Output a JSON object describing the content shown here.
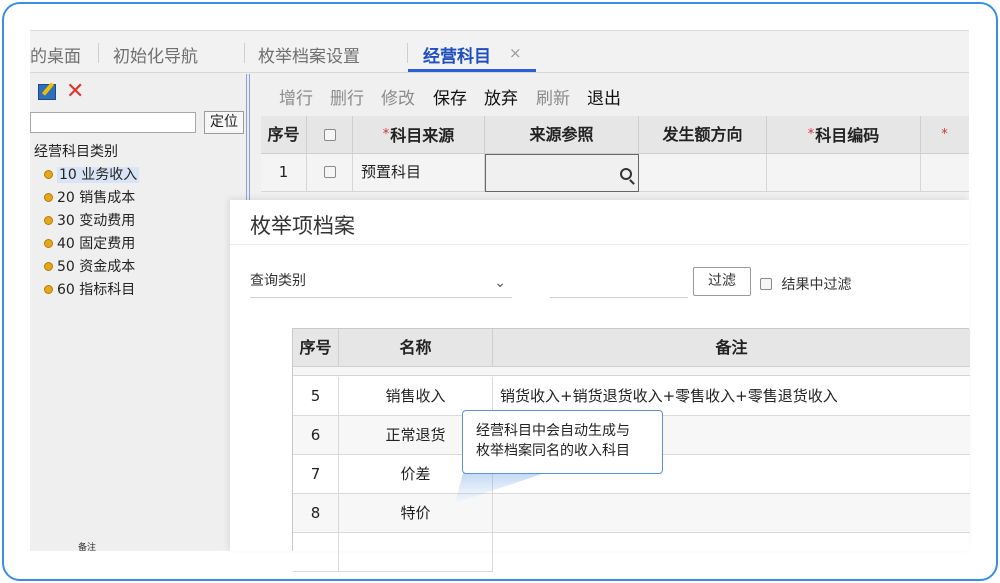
{
  "tabs": [
    {
      "label": "的桌面",
      "active": false
    },
    {
      "label": "初始化导航",
      "active": false
    },
    {
      "label": "枚举档案设置",
      "active": false
    },
    {
      "label": "经营科目",
      "active": true
    }
  ],
  "tab_close_glyph": "×",
  "left_panel": {
    "delete_glyph": "✕",
    "search_value": "",
    "locate_label": "定位",
    "tree_root": "经营科目类别",
    "tree_items": [
      {
        "label": "10 业务收入",
        "selected": true
      },
      {
        "label": "20 销售成本",
        "selected": false
      },
      {
        "label": "30 变动费用",
        "selected": false
      },
      {
        "label": "40 固定费用",
        "selected": false
      },
      {
        "label": "50 资金成本",
        "selected": false
      },
      {
        "label": "60 指标科目",
        "selected": false
      }
    ],
    "footer_text": "备注"
  },
  "toolbar": [
    {
      "label": "增行",
      "enabled": false
    },
    {
      "label": "删行",
      "enabled": false
    },
    {
      "label": "修改",
      "enabled": false
    },
    {
      "label": "保存",
      "enabled": true
    },
    {
      "label": "放弃",
      "enabled": true
    },
    {
      "label": "刷新",
      "enabled": false
    },
    {
      "label": "退出",
      "enabled": true
    }
  ],
  "main_grid": {
    "headers": [
      {
        "label": "序号",
        "required": false
      },
      {
        "label": "",
        "required": false,
        "checkbox": true
      },
      {
        "label": "科目来源",
        "required": true
      },
      {
        "label": "来源参照",
        "required": false
      },
      {
        "label": "发生额方向",
        "required": false
      },
      {
        "label": "科目编码",
        "required": true
      },
      {
        "label": "",
        "required": true
      }
    ],
    "rows": [
      {
        "seq": "1",
        "source": "预置科目",
        "reference": "",
        "direction": "",
        "code": ""
      }
    ],
    "required_mark": "*"
  },
  "dialog": {
    "title": "枚举项档案",
    "query_type_label": "查询类别",
    "query_value": "",
    "filter_button": "过滤",
    "filter_in_results_label": "结果中过滤",
    "columns": [
      "序号",
      "名称",
      "备注"
    ],
    "rows": [
      {
        "seq": "5",
        "name": "销售收入",
        "note": "销货收入+销货退货收入+零售收入+零售退货收入"
      },
      {
        "seq": "6",
        "name": "正常退货",
        "note": ""
      },
      {
        "seq": "7",
        "name": "价差",
        "note": ""
      },
      {
        "seq": "8",
        "name": "特价",
        "note": ""
      }
    ]
  },
  "callout": {
    "line1": "经营科目中会自动生成与",
    "line2": "枚举档案同名的收入科目"
  },
  "colors": {
    "frame_border": "#3a8ee6",
    "active_tab": "#1f4fbf",
    "delete_red": "#d83a2e",
    "tree_dot": "#e3a91a",
    "callout_border": "#5b93dd"
  }
}
